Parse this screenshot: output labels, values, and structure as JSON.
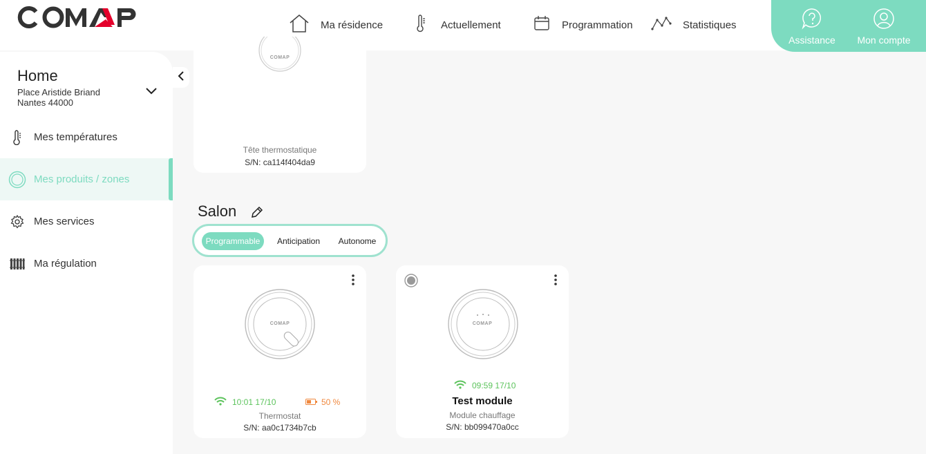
{
  "brand": {
    "logo_text": "COMAP",
    "accent": "#7ddbc0",
    "logo_red": "#e4002b"
  },
  "nav": {
    "items": [
      {
        "label": "Ma résidence",
        "icon": "house-icon"
      },
      {
        "label": "Actuellement",
        "icon": "thermometer-icon"
      },
      {
        "label": "Programmation",
        "icon": "calendar-icon"
      },
      {
        "label": "Statistiques",
        "icon": "line-chart-icon"
      }
    ],
    "assistance_label": "Assistance",
    "account_label": "Mon compte"
  },
  "sidebar": {
    "home_title": "Home",
    "address_line1": "Place Aristide Briand",
    "address_line2": "Nantes 44000",
    "items": [
      {
        "label": "Mes températures",
        "icon": "thermometer-icon"
      },
      {
        "label": "Mes produits / zones",
        "icon": "ring-icon",
        "active": true
      },
      {
        "label": "Mes services",
        "icon": "gear-icon"
      },
      {
        "label": "Ma régulation",
        "icon": "radiator-icon"
      }
    ]
  },
  "top_card": {
    "device_logo": "COMAP",
    "type": "Tête thermostatique",
    "serial": "S/N: ca114f404da9"
  },
  "zone": {
    "name": "Salon",
    "modes": [
      "Programmable",
      "Anticipation",
      "Autonome"
    ],
    "active_mode": "Programmable",
    "cards": [
      {
        "device_logo": "COMAP",
        "status_time": "10:01 17/10",
        "battery": "50 %",
        "type": "Thermostat",
        "serial": "S/N: aa0c1734b7cb"
      },
      {
        "device_logo": "COMAP",
        "status_time": "09:59 17/10",
        "name": "Test module",
        "type": "Module chauffage",
        "serial": "S/N: bb099470a0cc"
      }
    ]
  }
}
